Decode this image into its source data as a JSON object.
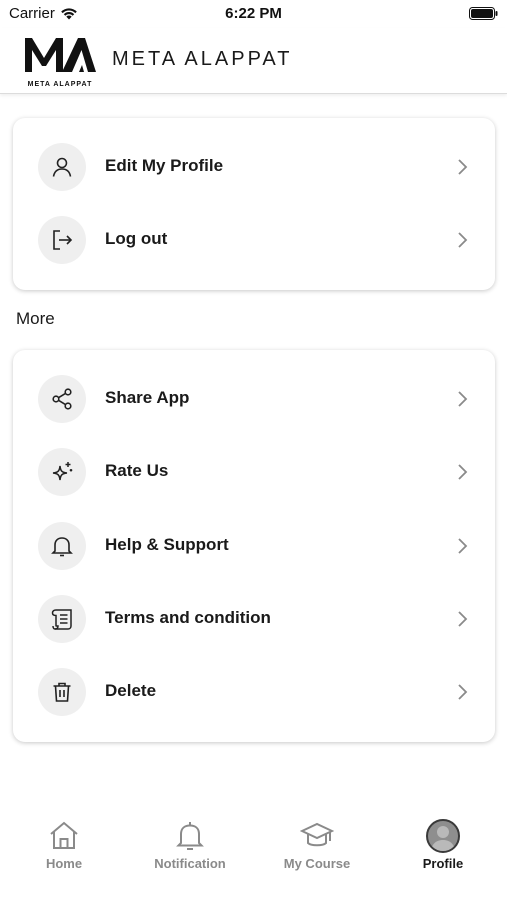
{
  "status_bar": {
    "carrier": "Carrier",
    "time": "6:22 PM"
  },
  "header": {
    "logo_letters": "MA",
    "logo_small_text": "META ALAPPAT",
    "brand_name": "META ALAPPAT"
  },
  "account_menu": [
    {
      "label": "Edit My Profile",
      "icon": "user-icon"
    },
    {
      "label": "Log out",
      "icon": "logout-icon"
    }
  ],
  "more_section": {
    "title": "More",
    "items": [
      {
        "label": "Share App",
        "icon": "share-icon"
      },
      {
        "label": "Rate Us",
        "icon": "sparkle-icon"
      },
      {
        "label": "Help & Support",
        "icon": "bell-icon"
      },
      {
        "label": "Terms and condition",
        "icon": "scroll-icon"
      },
      {
        "label": "Delete",
        "icon": "trash-icon"
      }
    ]
  },
  "tab_bar": {
    "tabs": [
      {
        "label": "Home",
        "icon": "home-icon"
      },
      {
        "label": "Notification",
        "icon": "bell-icon"
      },
      {
        "label": "My Course",
        "icon": "graduation-cap-icon"
      },
      {
        "label": "Profile",
        "icon": "avatar-icon",
        "active": true
      }
    ]
  }
}
